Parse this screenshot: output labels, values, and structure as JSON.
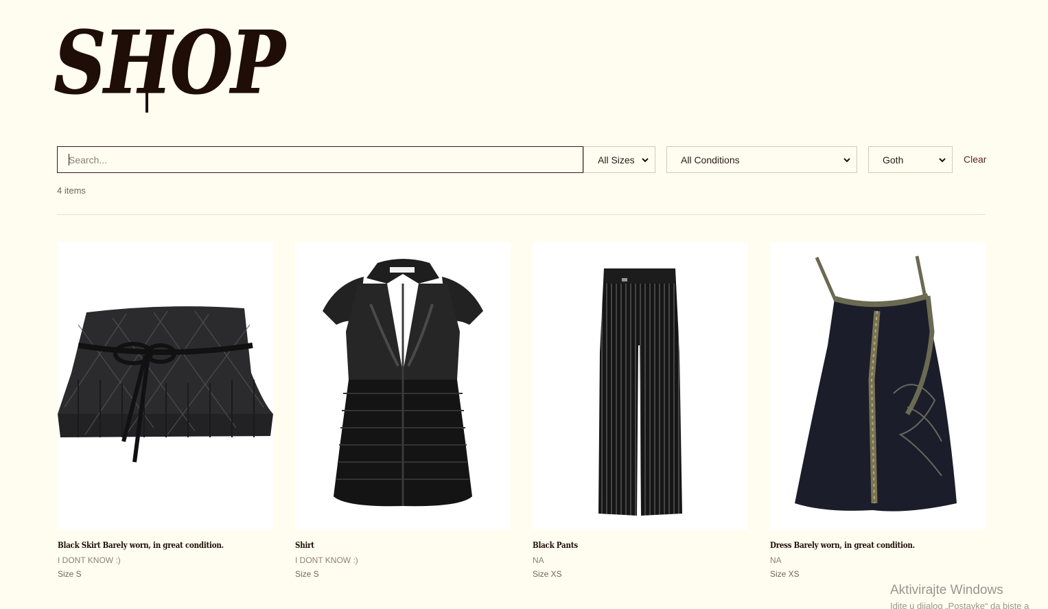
{
  "header": {
    "title": "SHOP"
  },
  "filters": {
    "search_placeholder": "Search...",
    "size_value": "All Sizes",
    "condition_value": "All Conditions",
    "style_value": "Goth",
    "clear_label": "Clear"
  },
  "results": {
    "count_label": "4 items"
  },
  "products": [
    {
      "name": "Black Skirt Barely worn, in great condition.",
      "condition": "I DONT KNOW :)",
      "size": "Size S",
      "image": "pleated-plaid-mini-skirt"
    },
    {
      "name": "Shirt",
      "condition": "I DONT KNOW :)",
      "size": "Size S",
      "image": "satin-smocked-blouse"
    },
    {
      "name": "Black Pants",
      "condition": "NA",
      "size": "Size XS",
      "image": "pinstripe-flared-pants"
    },
    {
      "name": "Dress Barely worn, in great condition.",
      "condition": "NA",
      "size": "Size XS",
      "image": "embellished-slip-dress"
    }
  ],
  "system": {
    "watermark_line1": "Aktivirajte Windows",
    "watermark_line2": "Idite u dijalog „Postavke“ da biste a"
  },
  "colors": {
    "background": "#fffdf0",
    "title": "#1f0d08",
    "search_border": "#3a1420",
    "clear_link": "#5a1f2a"
  }
}
